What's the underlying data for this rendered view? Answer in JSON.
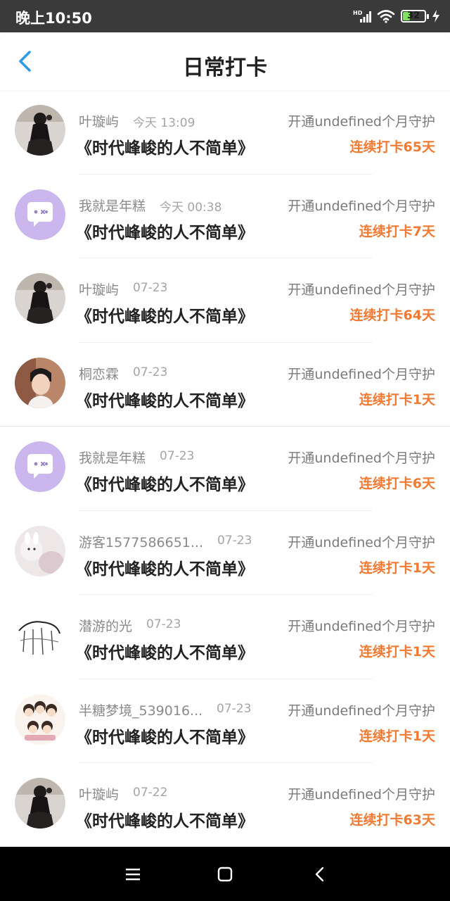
{
  "status_bar": {
    "time": "晚上10:50",
    "battery_level": "32",
    "battery_fraction": 0.32,
    "icons": [
      "hd-signal-icon",
      "wifi-icon",
      "battery-icon",
      "charging-icon"
    ]
  },
  "header": {
    "title": "日常打卡",
    "back_icon": "chevron-left-icon"
  },
  "colors": {
    "accent": "#2f9ae8",
    "streak": "#f07a32",
    "title": "#222222",
    "meta": "#8a8a8a"
  },
  "checkins": [
    {
      "user": "叶璇屿",
      "time": "今天 13:09",
      "title": "《时代峰峻的人不简单》",
      "promo": "开通undefined个月守护",
      "streak": "连续打卡65天",
      "avatar": "dark-dress-photo"
    },
    {
      "user": "我就是年糕",
      "time": "今天 00:38",
      "title": "《时代峰峻的人不简单》",
      "promo": "开通undefined个月守护",
      "streak": "连续打卡7天",
      "avatar": "default-chat-bubble"
    },
    {
      "user": "叶璇屿",
      "time": "07-23",
      "title": "《时代峰峻的人不简单》",
      "promo": "开通undefined个月守护",
      "streak": "连续打卡64天",
      "avatar": "dark-dress-photo"
    },
    {
      "user": "桐恋霖",
      "time": "07-23",
      "title": "《时代峰峻的人不简单》",
      "promo": "开通undefined个月守护",
      "streak": "连续打卡1天",
      "avatar": "boy-portrait-photo"
    },
    {
      "user": "我就是年糕",
      "time": "07-23",
      "title": "《时代峰峻的人不简单》",
      "promo": "开通undefined个月守护",
      "streak": "连续打卡6天",
      "avatar": "default-chat-bubble"
    },
    {
      "user": "游客1577586651...",
      "time": "07-23",
      "title": "《时代峰峻的人不简单》",
      "promo": "开通undefined个月守护",
      "streak": "连续打卡1天",
      "avatar": "bunny-photo"
    },
    {
      "user": "潜游的光",
      "time": "07-23",
      "title": "《时代峰峻的人不简单》",
      "promo": "开通undefined个月守护",
      "streak": "连续打卡1天",
      "avatar": "doodle-sketch"
    },
    {
      "user": "半糖梦境_539016...",
      "time": "07-23",
      "title": "《时代峰峻的人不简单》",
      "promo": "开通undefined个月守护",
      "streak": "连续打卡1天",
      "avatar": "cartoon-group"
    },
    {
      "user": "叶璇屿",
      "time": "07-22",
      "title": "《时代峰峻的人不简单》",
      "promo": "开通undefined个月守护",
      "streak": "连续打卡63天",
      "avatar": "dark-dress-photo"
    }
  ],
  "nav_bar": {
    "buttons": [
      "menu-icon",
      "home-square-icon",
      "back-triangle-icon"
    ]
  }
}
